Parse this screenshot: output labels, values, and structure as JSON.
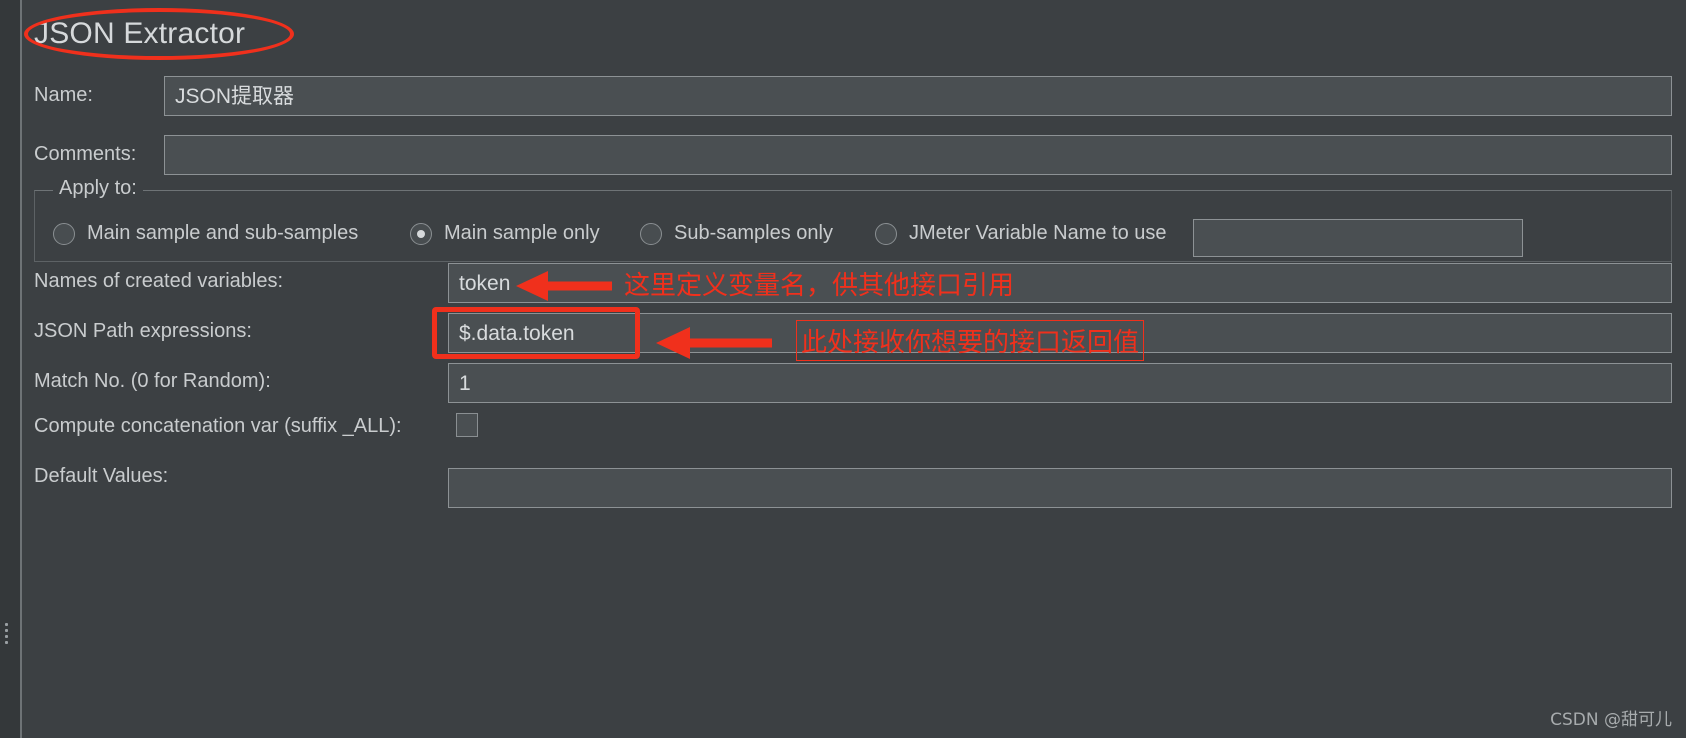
{
  "window": {
    "title": "JSON Extractor",
    "watermark": "CSDN @甜可儿"
  },
  "form": {
    "name_label": "Name:",
    "name_value": "JSON提取器",
    "comments_label": "Comments:",
    "comments_value": "",
    "apply_to_label": "Apply to:",
    "apply_to_options": [
      {
        "label": "Main sample and sub-samples",
        "selected": false
      },
      {
        "label": "Main sample only",
        "selected": true
      },
      {
        "label": "Sub-samples only",
        "selected": false
      },
      {
        "label": "JMeter Variable Name to use",
        "selected": false
      }
    ],
    "jmeter_variable_value": "",
    "names_label": "Names of created variables:",
    "names_value": "token",
    "jsonpath_label": "JSON Path expressions:",
    "jsonpath_value": "$.data.token",
    "match_no_label": "Match No. (0 for Random):",
    "match_no_value": "1",
    "compute_concat_label": "Compute concatenation var (suffix _ALL):",
    "compute_concat_checked": false,
    "default_values_label": "Default Values:",
    "default_values_value": ""
  },
  "annotations": {
    "accent_color": "#f0301c",
    "title_circle": "JSON Extractor",
    "note_variables": "这里定义变量名，供其他接口引用",
    "note_jsonpath": "此处接收你想要的接口返回值"
  }
}
